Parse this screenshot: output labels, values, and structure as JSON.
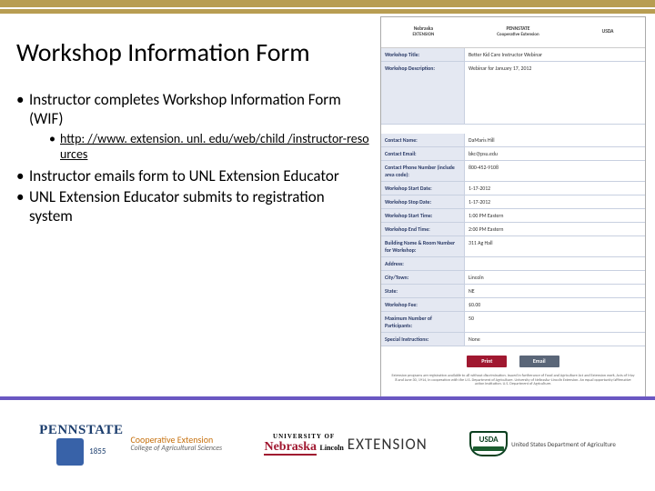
{
  "title": "Workshop Information Form",
  "bullets": {
    "b1": "Instructor completes Workshop Information Form (WIF)",
    "sub1": "http: //www. extension. unl. edu/web/child /instructor-resources",
    "b2": "Instructor emails form to UNL Extension Educator",
    "b3": "UNL Extension Educator submits to registration system"
  },
  "form": {
    "logos": {
      "neb": "Nebraska",
      "ext": "EXTENSION",
      "penn": "PENNSTATE",
      "coop": "Cooperative Extension",
      "usda": "USDA"
    },
    "rows": {
      "wt_label": "Workshop Title:",
      "wt_val": "Better Kid Care Instructor Webinar",
      "wd_label": "Workshop Description:",
      "wd_val": "Webinar for January 17, 2012",
      "cn_label": "Contact Name:",
      "cn_val": "DaMaris Hill",
      "ce_label": "Contact Email:",
      "ce_val": "bkc@psu.edu",
      "cp_label": "Contact Phone Number (include area code):",
      "cp_val": "800-452-9108",
      "sd_label": "Workshop Start Date:",
      "sd_val": "1-17-2012",
      "ed_label": "Workshop Stop Date:",
      "ed_val": "1-17-2012",
      "st_label": "Workshop Start Time:",
      "st_val": "1:00 PM Eastern",
      "et_label": "Workshop End Time:",
      "et_val": "2:00 PM Eastern",
      "bl_label": "Building Name & Room Number for Workshop:",
      "bl_val": "311 Ag Hall",
      "ad_label": "Address:",
      "ad_val": "",
      "ct_label": "City/Town:",
      "ct_val": "Lincoln",
      "stt_label": "State:",
      "stt_val": "NE",
      "fee_label": "Workshop Fee:",
      "fee_val": "$0.00",
      "max_label": "Maximum Number of Participants:",
      "max_val": "50",
      "si_label": "Special Instructions:",
      "si_val": "None"
    },
    "print": "Print",
    "email": "Email",
    "fine": "Extension programs are registration available to all without discrimination. Issued in furtherance of Food and Agriculture Act and Extension work, Acts of May 8 and June 30, 1914, in cooperation with the U.S. Department of Agriculture. University of Nebraska–Lincoln Extension. An equal opportunity/affirmative action institution. U.S. Department of Agriculture."
  },
  "footer": {
    "penn": "PENNSTATE",
    "year": "1855",
    "coop1": "Cooperative Extension",
    "coop2": "College of Agricultural Sciences",
    "neb_univ": "UNIVERSITY OF",
    "neb": "Nebraska",
    "neb_lincoln": "Lincoln",
    "ext": "EXTENSION",
    "usda": "USDA",
    "usda_txt": "United States Department of Agriculture"
  }
}
